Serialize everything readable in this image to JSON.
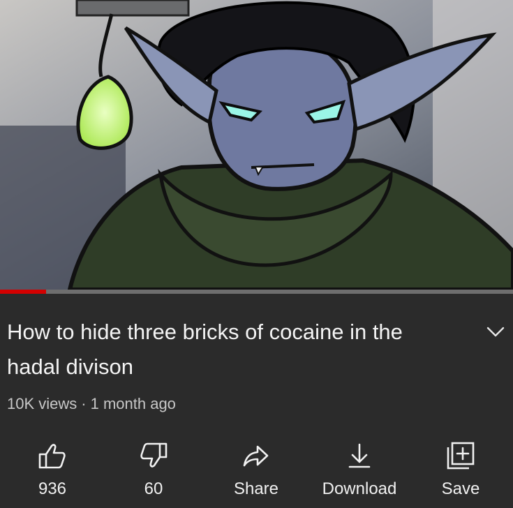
{
  "video": {
    "title": "How to hide three bricks of cocaine in the hadal divison",
    "progress": 0.09
  },
  "meta": {
    "views": "10K views",
    "separator": "·",
    "age": "1 month ago"
  },
  "actions": {
    "like": {
      "label": "936",
      "icon": "thumbs-up-icon"
    },
    "dislike": {
      "label": "60",
      "icon": "thumbs-down-icon"
    },
    "share": {
      "label": "Share",
      "icon": "share-arrow-icon"
    },
    "download": {
      "label": "Download",
      "icon": "download-icon"
    },
    "save": {
      "label": "Save",
      "icon": "add-to-playlist-icon"
    }
  },
  "colors": {
    "background": "#2b2b2b",
    "progress": "#d40000",
    "text": "#f1f1f1",
    "subtext": "#c8c8c8"
  }
}
